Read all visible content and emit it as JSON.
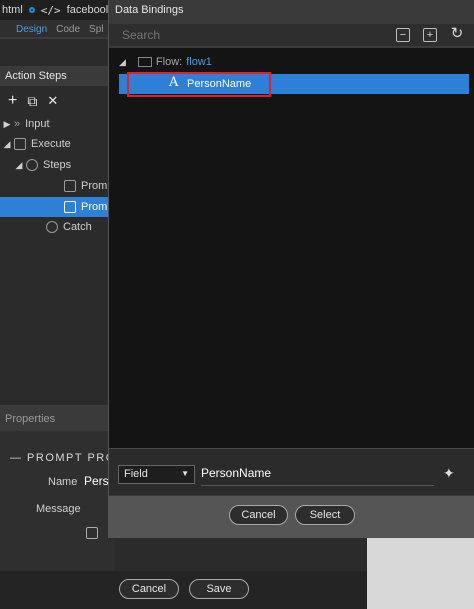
{
  "tabbar": {
    "html_tab": "html",
    "facebook_tab": "facebool"
  },
  "subtabs": {
    "design": "Design",
    "code": "Code",
    "split": "Spl"
  },
  "action_steps": {
    "title": "Action Steps",
    "toolbar": {
      "add": "+",
      "copy": "⧉",
      "delete": "✕"
    },
    "tree": {
      "input": "Input",
      "execute": "Execute",
      "steps": "Steps",
      "prompt1": "Promp",
      "prompt2": "Promp",
      "catch": "Catch"
    }
  },
  "properties": {
    "title": "Properties",
    "section": "— PROMPT PRO",
    "name_label": "Name",
    "name_value": "Perso",
    "message_label": "Message"
  },
  "bottom": {
    "cancel": "Cancel",
    "save": "Save"
  },
  "dialog": {
    "title": "Data Bindings",
    "search_placeholder": "Search",
    "toolbar": {
      "collapse": "−",
      "expand": "+",
      "refresh": "↻"
    },
    "tree": {
      "flow_label": "Flow:",
      "flow_value": "flow1",
      "selected_item": "PersonName",
      "item_type_glyph": "A"
    },
    "field_select": "Field",
    "field_value": "PersonName",
    "cancel": "Cancel",
    "select": "Select"
  },
  "colors": {
    "accent": "#2e7fd6",
    "highlight": "#e0212b"
  }
}
